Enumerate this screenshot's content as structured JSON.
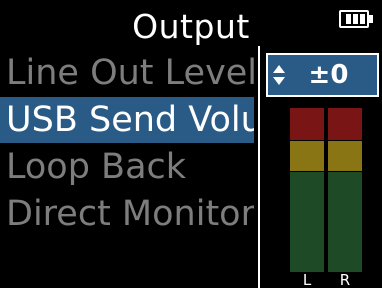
{
  "header": {
    "title": "Output",
    "battery_icon": "battery-icon"
  },
  "menu": {
    "items": [
      {
        "label": "Line Out Level",
        "selected": false
      },
      {
        "label": "USB Send Volume",
        "selected": true
      },
      {
        "label": "Loop Back",
        "selected": false
      },
      {
        "label": "Direct Monitor",
        "selected": false
      }
    ]
  },
  "value_box": {
    "value": "±0",
    "icon": "up-down-arrows-icon"
  },
  "meters": {
    "left_label": "L",
    "right_label": "R"
  },
  "colors": {
    "selection": "#2a5b86",
    "meter_red": "#7a1515",
    "meter_yellow": "#8a7515",
    "meter_green": "#1e4a26",
    "inactive_text": "#7d7d7d"
  }
}
